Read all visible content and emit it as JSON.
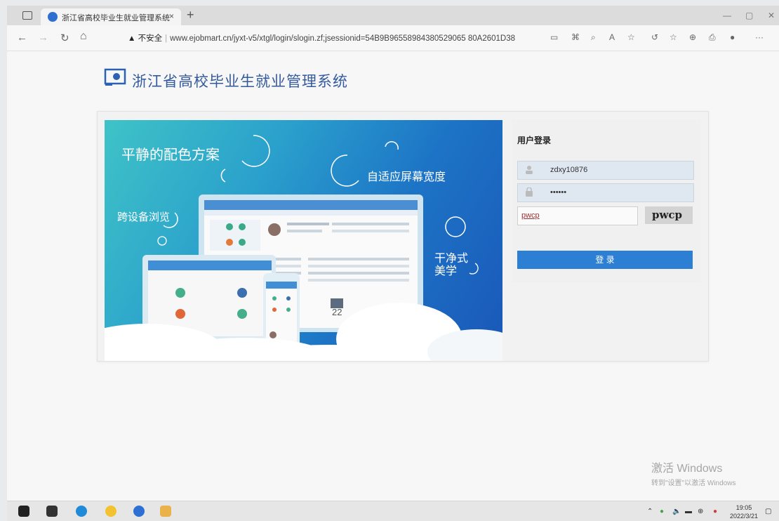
{
  "browser": {
    "tab_title": "浙江省高校毕业生就业管理系统",
    "tab_close": "×",
    "new_tab": "+",
    "security_label": "▲ 不安全",
    "url": "www.ejobmart.cn/jyxt-v5/xtgl/login/slogin.zf;jsessionid=54B9B96558984380529065 80A2601D38"
  },
  "header": {
    "title": "浙江省高校毕业生就业管理系统"
  },
  "banner": {
    "text1": "平静的配色方案",
    "text2": "自适应屏幕宽度",
    "text3": "跨设备浏览",
    "text4a": "干净式",
    "text4b": "美学"
  },
  "login": {
    "heading": "用户登录",
    "username_value": "zdxy10876",
    "password_value": "••••••",
    "captcha_value": "pwcp",
    "captcha_image_text": "pwcp",
    "submit_label": "登 录"
  },
  "watermark": {
    "line1": "激活 Windows",
    "line2": "转到\"设置\"以激活 Windows"
  },
  "taskbar": {
    "time": "19:05",
    "date": "2022/3/21"
  }
}
